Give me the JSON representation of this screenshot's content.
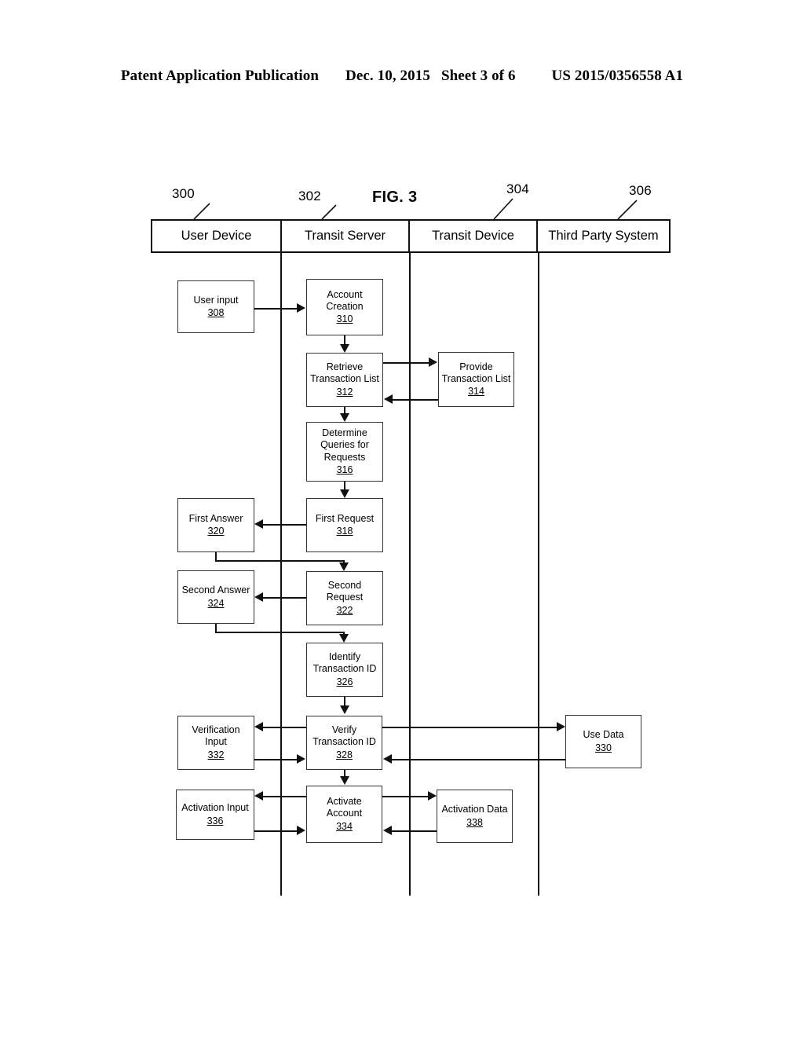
{
  "patent_header": {
    "publication": "Patent Application Publication",
    "date": "Dec. 10, 2015",
    "sheet": "Sheet 3 of 6",
    "number": "US 2015/0356558 A1"
  },
  "figure": {
    "label": "FIG. 3"
  },
  "lanes": [
    {
      "title": "User Device",
      "ref": "300"
    },
    {
      "title": "Transit Server",
      "ref": "302"
    },
    {
      "title": "Transit Device",
      "ref": "304"
    },
    {
      "title": "Third Party System",
      "ref": "306"
    }
  ],
  "nodes": [
    {
      "id": "n308",
      "lane": "User Device",
      "label": "User input",
      "num": "308"
    },
    {
      "id": "n310",
      "lane": "Transit Server",
      "label": "Account\nCreation",
      "num": "310"
    },
    {
      "id": "n312",
      "lane": "Transit Server",
      "label": "Retrieve\nTransaction List",
      "num": "312"
    },
    {
      "id": "n314",
      "lane": "Transit Device",
      "label": "Provide\nTransaction List",
      "num": "314"
    },
    {
      "id": "n316",
      "lane": "Transit Server",
      "label": "Determine\nQueries for\nRequests",
      "num": "316"
    },
    {
      "id": "n318",
      "lane": "Transit Server",
      "label": "First Request",
      "num": "318"
    },
    {
      "id": "n320",
      "lane": "User Device",
      "label": "First Answer",
      "num": "320"
    },
    {
      "id": "n322",
      "lane": "Transit Server",
      "label": "Second Request",
      "num": "322"
    },
    {
      "id": "n324",
      "lane": "User Device",
      "label": "Second Answer",
      "num": "324"
    },
    {
      "id": "n326",
      "lane": "Transit Server",
      "label": "Identify\nTransaction ID",
      "num": "326"
    },
    {
      "id": "n328",
      "lane": "Transit Server",
      "label": "Verify\nTransaction ID",
      "num": "328"
    },
    {
      "id": "n330",
      "lane": "Third Party System",
      "label": "Use Data",
      "num": "330"
    },
    {
      "id": "n332",
      "lane": "User Device",
      "label": "Verification\nInput",
      "num": "332"
    },
    {
      "id": "n334",
      "lane": "Transit Server",
      "label": "Activate\nAccount",
      "num": "334"
    },
    {
      "id": "n336",
      "lane": "User Device",
      "label": "Activation Input",
      "num": "336"
    },
    {
      "id": "n338",
      "lane": "Transit Device",
      "label": "Activation Data",
      "num": "338"
    }
  ],
  "colors": {
    "ink": "#111111",
    "paper": "#ffffff"
  }
}
